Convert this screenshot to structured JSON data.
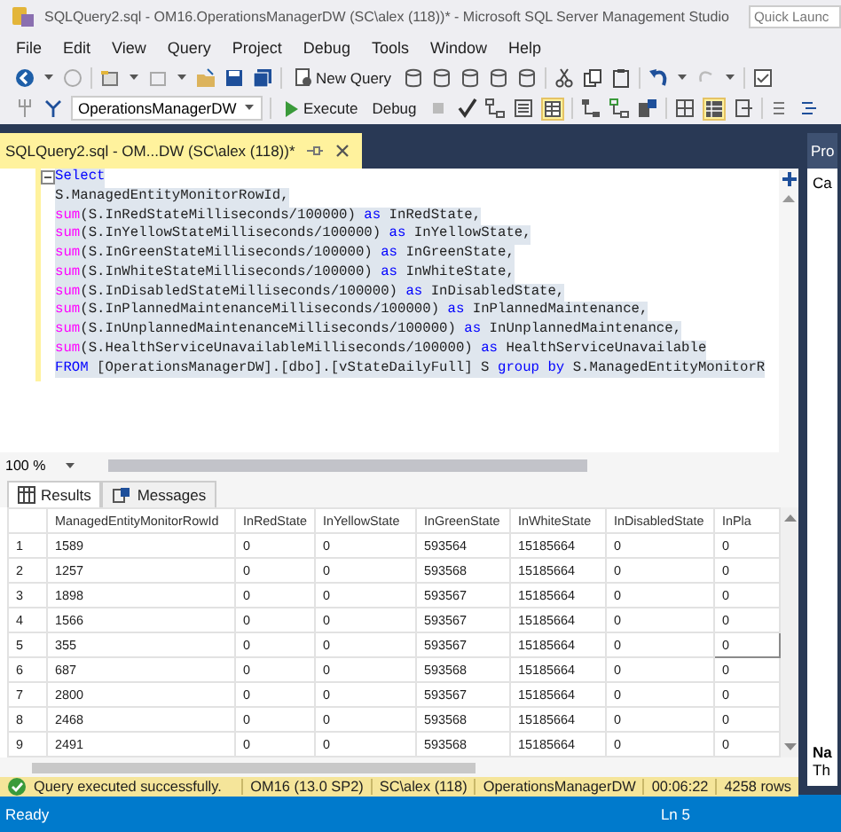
{
  "window": {
    "title": "SQLQuery2.sql - OM16.OperationsManagerDW (SC\\alex (118))* - Microsoft SQL Server Management Studio",
    "quick_launch": {
      "placeholder": "Quick Launc"
    }
  },
  "menu": [
    "File",
    "Edit",
    "View",
    "Query",
    "Project",
    "Debug",
    "Tools",
    "Window",
    "Help"
  ],
  "toolbar": {
    "new_query": "New Query",
    "database": "OperationsManagerDW",
    "execute": "Execute",
    "debug": "Debug"
  },
  "document_tab": {
    "title": "SQLQuery2.sql - OM...DW (SC\\alex (118))*",
    "selected": true
  },
  "editor": {
    "selected": true,
    "zoom": "100 %",
    "lines": [
      [
        {
          "kind": "keyword",
          "text": "Select"
        }
      ],
      [
        {
          "kind": "plain",
          "text": "S.ManagedEntityMonitorRowId,"
        }
      ],
      [
        {
          "kind": "function",
          "text": "sum"
        },
        {
          "kind": "plain",
          "text": "(S.InRedStateMilliseconds/100000) "
        },
        {
          "kind": "keyword",
          "text": "as"
        },
        {
          "kind": "plain",
          "text": " InRedState,"
        }
      ],
      [
        {
          "kind": "function",
          "text": "sum"
        },
        {
          "kind": "plain",
          "text": "(S.InYellowStateMilliseconds/100000) "
        },
        {
          "kind": "keyword",
          "text": "as"
        },
        {
          "kind": "plain",
          "text": " InYellowState,"
        }
      ],
      [
        {
          "kind": "function",
          "text": "sum"
        },
        {
          "kind": "plain",
          "text": "(S.InGreenStateMilliseconds/100000) "
        },
        {
          "kind": "keyword",
          "text": "as"
        },
        {
          "kind": "plain",
          "text": " InGreenState,"
        }
      ],
      [
        {
          "kind": "function",
          "text": "sum"
        },
        {
          "kind": "plain",
          "text": "(S.InWhiteStateMilliseconds/100000) "
        },
        {
          "kind": "keyword",
          "text": "as"
        },
        {
          "kind": "plain",
          "text": " InWhiteState,"
        }
      ],
      [
        {
          "kind": "function",
          "text": "sum"
        },
        {
          "kind": "plain",
          "text": "(S.InDisabledStateMilliseconds/100000) "
        },
        {
          "kind": "keyword",
          "text": "as"
        },
        {
          "kind": "plain",
          "text": " InDisabledState,"
        }
      ],
      [
        {
          "kind": "function",
          "text": "sum"
        },
        {
          "kind": "plain",
          "text": "(S.InPlannedMaintenanceMilliseconds/100000) "
        },
        {
          "kind": "keyword",
          "text": "as"
        },
        {
          "kind": "plain",
          "text": " InPlannedMaintenance,"
        }
      ],
      [
        {
          "kind": "function",
          "text": "sum"
        },
        {
          "kind": "plain",
          "text": "(S.InUnplannedMaintenanceMilliseconds/100000) "
        },
        {
          "kind": "keyword",
          "text": "as"
        },
        {
          "kind": "plain",
          "text": " InUnplannedMaintenance,"
        }
      ],
      [
        {
          "kind": "function",
          "text": "sum"
        },
        {
          "kind": "plain",
          "text": "(S.HealthServiceUnavailableMilliseconds/100000) "
        },
        {
          "kind": "keyword",
          "text": "as"
        },
        {
          "kind": "plain",
          "text": " HealthServiceUnavailable"
        }
      ],
      [
        {
          "kind": "keyword",
          "text": "FROM"
        },
        {
          "kind": "plain",
          "text": " [OperationsManagerDW].[dbo].[vStateDailyFull] S "
        },
        {
          "kind": "keyword",
          "text": "group by"
        },
        {
          "kind": "plain",
          "text": " S.ManagedEntityMonitorR"
        }
      ]
    ]
  },
  "results": {
    "tabs": [
      {
        "label": "Results",
        "selected": true
      },
      {
        "label": "Messages",
        "selected": false
      }
    ],
    "columns": [
      "ManagedEntityMonitorRowId",
      "InRedState",
      "InYellowState",
      "InGreenState",
      "InWhiteState",
      "InDisabledState",
      "InPla"
    ],
    "rows": [
      {
        "number": "1",
        "cells": [
          "1589",
          "0",
          "0",
          "593564",
          "15185664",
          "0",
          "0"
        ],
        "focused": false
      },
      {
        "number": "2",
        "cells": [
          "1257",
          "0",
          "0",
          "593568",
          "15185664",
          "0",
          "0"
        ],
        "focused": false
      },
      {
        "number": "3",
        "cells": [
          "1898",
          "0",
          "0",
          "593567",
          "15185664",
          "0",
          "0"
        ],
        "focused": false
      },
      {
        "number": "4",
        "cells": [
          "1566",
          "0",
          "0",
          "593567",
          "15185664",
          "0",
          "0"
        ],
        "focused": false
      },
      {
        "number": "5",
        "cells": [
          "355",
          "0",
          "0",
          "593567",
          "15185664",
          "0",
          "0"
        ],
        "focused": true
      },
      {
        "number": "6",
        "cells": [
          "687",
          "0",
          "0",
          "593568",
          "15185664",
          "0",
          "0"
        ],
        "focused": false
      },
      {
        "number": "7",
        "cells": [
          "2800",
          "0",
          "0",
          "593567",
          "15185664",
          "0",
          "0"
        ],
        "focused": false
      },
      {
        "number": "8",
        "cells": [
          "2468",
          "0",
          "0",
          "593568",
          "15185664",
          "0",
          "0"
        ],
        "focused": false
      },
      {
        "number": "9",
        "cells": [
          "2491",
          "0",
          "0",
          "593568",
          "15185664",
          "0",
          "0"
        ],
        "focused": false
      }
    ]
  },
  "query_status": {
    "message": "Query executed successfully.",
    "server": "OM16 (13.0 SP2)",
    "user": "SC\\alex (118)",
    "database": "OperationsManagerDW",
    "elapsed": "00:06:22",
    "rows": "4258 rows"
  },
  "properties_panel": {
    "title": "Pro",
    "top_text": "Ca",
    "name_label": "Na",
    "description": "Th"
  },
  "status_bar": {
    "state": "Ready",
    "position": "Ln 5"
  }
}
